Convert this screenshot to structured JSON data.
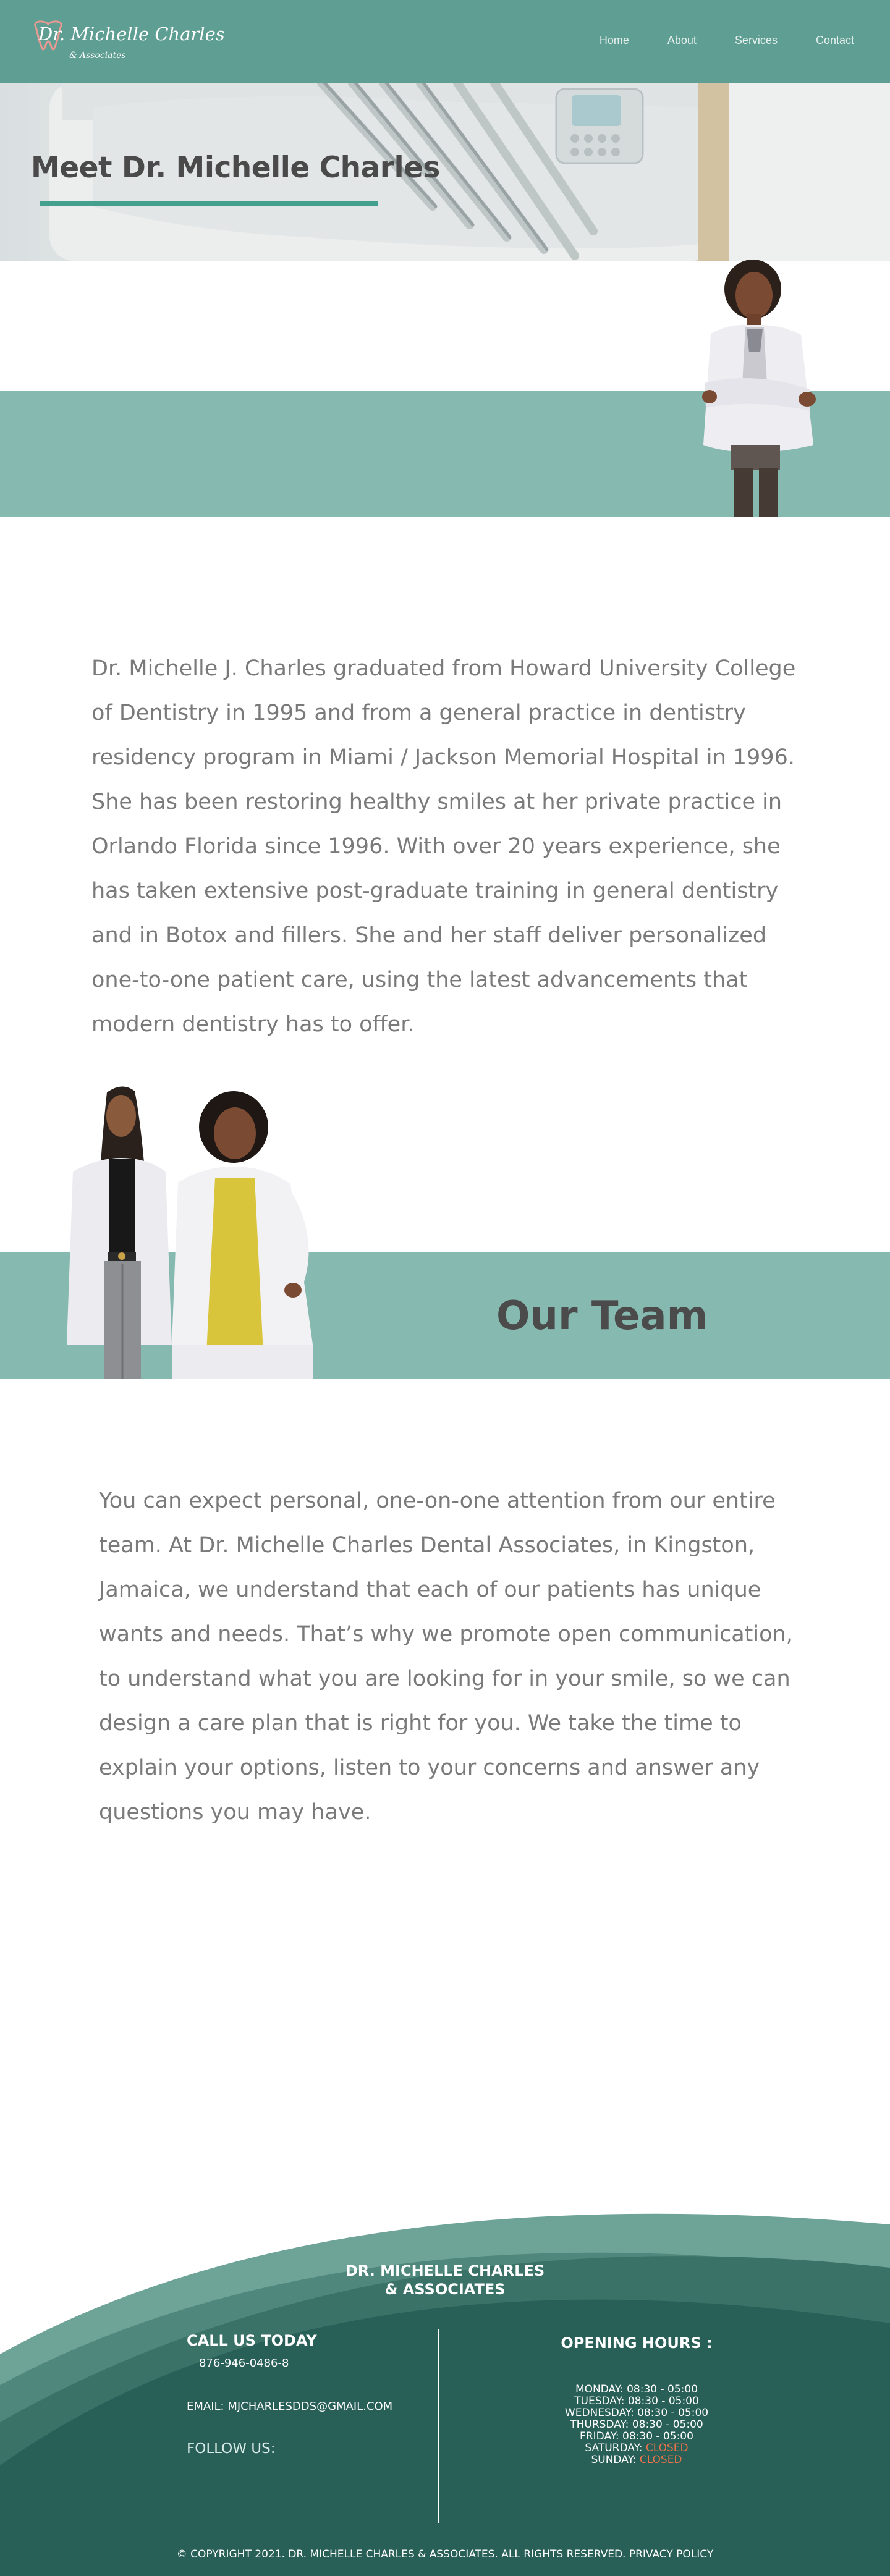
{
  "header": {
    "logo_main": "Dr. Michelle Charles",
    "logo_sub": "& Associates",
    "nav": [
      {
        "label": "Home"
      },
      {
        "label": "About"
      },
      {
        "label": "Services"
      },
      {
        "label": "Contact"
      }
    ]
  },
  "hero": {
    "title": "Meet Dr. Michelle Charles"
  },
  "about": {
    "paragraph": "Dr. Michelle J. Charles graduated from Howard University College of Dentistry in 1995 and from a general practice in dentistry residency program in Miami / Jackson Memorial Hospital in 1996. She has been restoring healthy smiles at her private practice in Orlando Florida since 1996. With over 20 years experience, she has taken extensive post-graduate training in general dentistry and in Botox and fillers. She and her staff deliver personalized one-to-one patient care, using the latest advancements that modern dentistry has to offer."
  },
  "team": {
    "heading": "Our Team",
    "paragraph": "You can expect personal, one-on-one attention from our entire team. At Dr. Michelle Charles Dental Associates, in Kingston, Jamaica, we understand that each of our patients has unique wants and needs. That’s why we promote open communication, to understand what you are looking for in your smile, so we can design a care plan that is right for you. We take the time to explain your options, listen to your concerns and answer any questions you may have."
  },
  "footer": {
    "brand_line1": "DR. MICHELLE CHARLES",
    "brand_line2": "& ASSOCIATES",
    "call_title": "CALL US TODAY",
    "phone": "876-946-0486-8",
    "email": "EMAIL: MJCHARLESDDS@GMAIL.COM",
    "follow": "FOLLOW US:",
    "social": [
      "facebook-icon",
      "instagram-icon",
      "twitter-icon"
    ],
    "hours_title": "OPENING HOURS :",
    "hours": [
      {
        "day": "MONDAY:",
        "time": "08:30 - 05:00",
        "closed": false
      },
      {
        "day": "TUESDAY:",
        "time": "08:30 - 05:00",
        "closed": false
      },
      {
        "day": "WEDNESDAY:",
        "time": "08:30 - 05:00",
        "closed": false
      },
      {
        "day": "THURSDAY:",
        "time": "08:30 - 05:00",
        "closed": false
      },
      {
        "day": "FRIDAY:",
        "time": "08:30 - 05:00",
        "closed": false
      },
      {
        "day": "SATURDAY:",
        "time": "CLOSED",
        "closed": true
      },
      {
        "day": "SUNDAY:",
        "time": "CLOSED",
        "closed": true
      }
    ],
    "copyright": "© COPYRIGHT 2021. DR. MICHELLE CHARLES & ASSOCIATES. ALL RIGHTS RESERVED. PRIVACY POLICY"
  },
  "colors": {
    "header_bg": "#5f9e93",
    "band_bg": "#86b9b0",
    "accent_rule": "#43a08f",
    "footer_dark": "#285f57",
    "closed_text": "#e9734a"
  }
}
